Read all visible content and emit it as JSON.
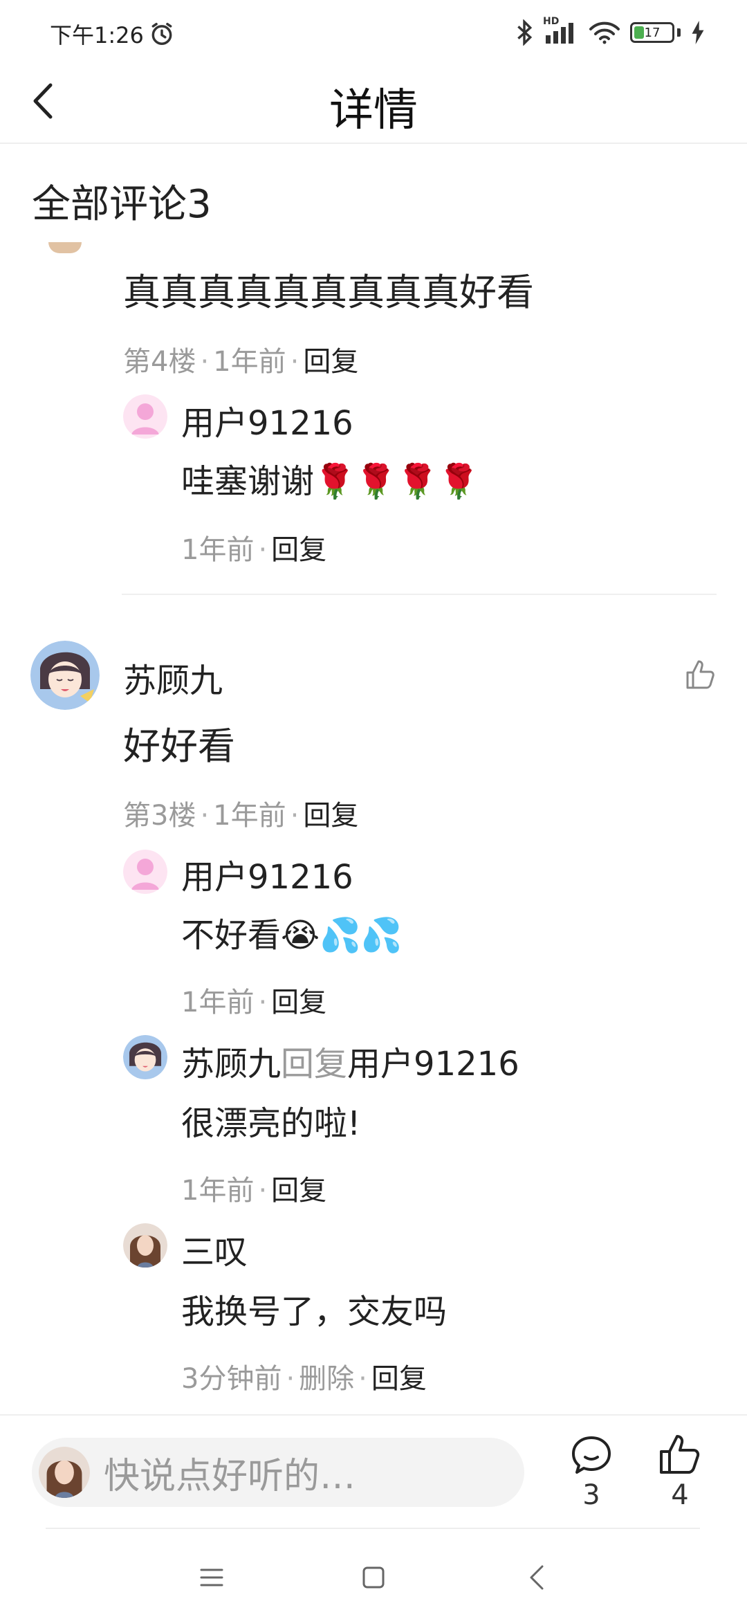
{
  "status_bar": {
    "time": "下午1:26",
    "network_label": "HD",
    "battery_level": "17",
    "icons": [
      "alarm-clock-icon",
      "bluetooth-icon",
      "signal-icon",
      "wifi-icon",
      "battery-icon",
      "charging-icon"
    ]
  },
  "header": {
    "title": "详情",
    "back_icon": "chevron-left-icon"
  },
  "comments_section": {
    "title": "全部评论3"
  },
  "comments": [
    {
      "text": "真真真真真真真真真好看",
      "floor": "第4楼",
      "time": "1年前",
      "reply_label": "回复",
      "replies": [
        {
          "user": "用户91216",
          "text": "哇塞谢谢🌹🌹🌹🌹",
          "time": "1年前",
          "reply_label": "回复"
        }
      ]
    },
    {
      "user": "苏顾九",
      "text": "好好看",
      "floor": "第3楼",
      "time": "1年前",
      "reply_label": "回复",
      "replies": [
        {
          "user": "用户91216",
          "text": "不好看😭💦💦",
          "time": "1年前",
          "reply_label": "回复"
        },
        {
          "user": "苏顾九",
          "reply_word": "回复",
          "target_user": "用户91216",
          "text": "很漂亮的啦!",
          "time": "1年前",
          "reply_label": "回复"
        },
        {
          "user": "三叹",
          "text": "我换号了，交友吗",
          "time": "3分钟前",
          "delete_label": "删除",
          "reply_label": "回复"
        }
      ]
    }
  ],
  "bottom_bar": {
    "input_placeholder": "快说点好听的…",
    "comment_count": "3",
    "like_count": "4"
  },
  "colors": {
    "text_primary": "#222222",
    "text_secondary": "#9a9a9a",
    "divider": "#eeeeee",
    "input_bg": "#f3f3f3",
    "battery_green": "#4caf50"
  }
}
